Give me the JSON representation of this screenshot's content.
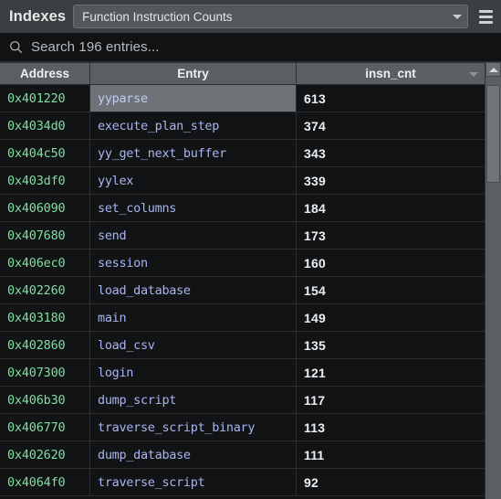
{
  "toolbar": {
    "title": "Indexes",
    "selected_index": "Function Instruction Counts",
    "dropdown_icon": "chevron-down-icon",
    "menu_icon": "hamburger-menu-icon"
  },
  "search": {
    "icon": "search-icon",
    "placeholder": "Search 196 entries...",
    "value": "",
    "entry_count": 196
  },
  "table": {
    "columns": [
      {
        "key": "address",
        "label": "Address",
        "sorted": false
      },
      {
        "key": "entry",
        "label": "Entry",
        "sorted": false
      },
      {
        "key": "insn_cnt",
        "label": "insn_cnt",
        "sorted": true,
        "sort_icon": "sort-descending-caret"
      }
    ],
    "selected_row_index": 0,
    "rows": [
      {
        "address": "0x401220",
        "entry": "yyparse",
        "insn_cnt": "613"
      },
      {
        "address": "0x4034d0",
        "entry": "execute_plan_step",
        "insn_cnt": "374"
      },
      {
        "address": "0x404c50",
        "entry": "yy_get_next_buffer",
        "insn_cnt": "343"
      },
      {
        "address": "0x403df0",
        "entry": "yylex",
        "insn_cnt": "339"
      },
      {
        "address": "0x406090",
        "entry": "set_columns",
        "insn_cnt": "184"
      },
      {
        "address": "0x407680",
        "entry": "send",
        "insn_cnt": "173"
      },
      {
        "address": "0x406ec0",
        "entry": "session",
        "insn_cnt": "160"
      },
      {
        "address": "0x402260",
        "entry": "load_database",
        "insn_cnt": "154"
      },
      {
        "address": "0x403180",
        "entry": "main",
        "insn_cnt": "149"
      },
      {
        "address": "0x402860",
        "entry": "load_csv",
        "insn_cnt": "135"
      },
      {
        "address": "0x407300",
        "entry": "login",
        "insn_cnt": "121"
      },
      {
        "address": "0x406b30",
        "entry": "dump_script",
        "insn_cnt": "117"
      },
      {
        "address": "0x406770",
        "entry": "traverse_script_binary",
        "insn_cnt": "113"
      },
      {
        "address": "0x402620",
        "entry": "dump_database",
        "insn_cnt": "111"
      },
      {
        "address": "0x4064f0",
        "entry": "traverse_script",
        "insn_cnt": "92"
      }
    ]
  },
  "scrollbar": {
    "up_arrow_icon": "scroll-up-arrow-icon",
    "position": "top"
  },
  "colors": {
    "toolbar_bg": "#3a3f42",
    "search_bg": "#101214",
    "table_bg": "#111315",
    "header_bg": "#5a5f62",
    "address_text": "#7ee0a0",
    "entry_text": "#a8b6ef",
    "count_text": "#eceff1",
    "selection_bg": "#6d7376"
  }
}
